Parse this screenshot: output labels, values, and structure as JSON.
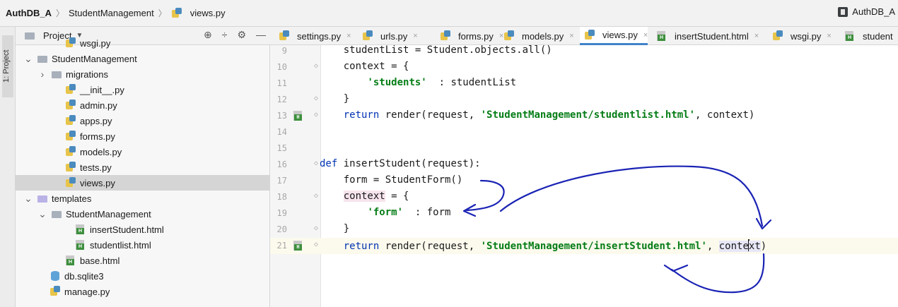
{
  "breadcrumb": {
    "items": [
      "AuthDB_A",
      "StudentManagement",
      "views.py"
    ],
    "right_label": "AuthDB_A"
  },
  "toolstrip": {
    "label": "1: Project"
  },
  "project_panel": {
    "title": "Project",
    "tree": [
      {
        "label": "wsgi.py",
        "icon": "py",
        "indent": 70
      },
      {
        "label": "StudentManagement",
        "icon": "folder",
        "indent": 30,
        "chev": "open"
      },
      {
        "label": "migrations",
        "icon": "folder",
        "indent": 50,
        "chev": "closed"
      },
      {
        "label": "__init__.py",
        "icon": "py",
        "indent": 70
      },
      {
        "label": "admin.py",
        "icon": "py",
        "indent": 70
      },
      {
        "label": "apps.py",
        "icon": "py",
        "indent": 70
      },
      {
        "label": "forms.py",
        "icon": "py",
        "indent": 70
      },
      {
        "label": "models.py",
        "icon": "py",
        "indent": 70
      },
      {
        "label": "tests.py",
        "icon": "py",
        "indent": 70
      },
      {
        "label": "views.py",
        "icon": "py",
        "indent": 70,
        "selected": true
      },
      {
        "label": "templates",
        "icon": "folder-t",
        "indent": 30,
        "chev": "open"
      },
      {
        "label": "StudentManagement",
        "icon": "folder",
        "indent": 50,
        "chev": "open"
      },
      {
        "label": "insertStudent.html",
        "icon": "html",
        "indent": 84
      },
      {
        "label": "studentlist.html",
        "icon": "html",
        "indent": 84
      },
      {
        "label": "base.html",
        "icon": "html",
        "indent": 70
      },
      {
        "label": "db.sqlite3",
        "icon": "db",
        "indent": 48
      },
      {
        "label": "manage.py",
        "icon": "py",
        "indent": 48
      }
    ]
  },
  "tabs": [
    {
      "label": "settings.py",
      "icon": "py"
    },
    {
      "label": "urls.py",
      "icon": "py"
    },
    {
      "label": "forms.py",
      "icon": "py"
    },
    {
      "label": "models.py",
      "icon": "py"
    },
    {
      "label": "views.py",
      "icon": "py",
      "active": true
    },
    {
      "label": "insertStudent.html",
      "icon": "html"
    },
    {
      "label": "wsgi.py",
      "icon": "py"
    },
    {
      "label": "student",
      "icon": "html"
    }
  ],
  "editor": {
    "lines": [
      {
        "n": "9",
        "segs": [
          [
            "    studentList = Student.objects.all()",
            ""
          ]
        ]
      },
      {
        "n": "10",
        "segs": [
          [
            "    context = {",
            ""
          ]
        ]
      },
      {
        "n": "11",
        "segs": [
          [
            "        ",
            ""
          ],
          [
            "'students'",
            "str"
          ],
          [
            "  : studentList",
            ""
          ]
        ]
      },
      {
        "n": "12",
        "segs": [
          [
            "    }",
            ""
          ]
        ]
      },
      {
        "n": "13",
        "segs": [
          [
            "    ",
            ""
          ],
          [
            "return",
            "kw"
          ],
          [
            " render(request, ",
            ""
          ],
          [
            "'StudentManagement/studentlist.html'",
            "str"
          ],
          [
            ", context)",
            ""
          ]
        ]
      },
      {
        "n": "14",
        "segs": []
      },
      {
        "n": "15",
        "segs": []
      },
      {
        "n": "16",
        "segs": [
          [
            "def",
            "kw"
          ],
          [
            " insertStudent(request):",
            ""
          ]
        ]
      },
      {
        "n": "17",
        "segs": [
          [
            "    form = StudentForm()",
            ""
          ]
        ]
      },
      {
        "n": "18",
        "segs": [
          [
            "    ",
            ""
          ],
          [
            "context",
            "hl"
          ],
          [
            " = {",
            ""
          ]
        ]
      },
      {
        "n": "19",
        "segs": [
          [
            "        ",
            ""
          ],
          [
            "'form'",
            "str"
          ],
          [
            "  : form",
            ""
          ]
        ]
      },
      {
        "n": "20",
        "segs": [
          [
            "    }",
            ""
          ]
        ]
      },
      {
        "n": "21",
        "segs": [
          [
            "    ",
            ""
          ],
          [
            "return",
            "kw"
          ],
          [
            " render(request, ",
            ""
          ],
          [
            "'StudentManagement/insertStudent.html'",
            "str"
          ],
          [
            ", ",
            ""
          ],
          [
            "conte",
            "hl-ident"
          ],
          [
            "|caret|",
            "caret"
          ],
          [
            "xt",
            "hl-ident"
          ],
          [
            ")",
            ""
          ]
        ]
      }
    ]
  },
  "colors": {
    "accent": "#4083c9",
    "keyword": "#0033b3",
    "string": "#067d17",
    "annotation": "#1a23b4"
  }
}
